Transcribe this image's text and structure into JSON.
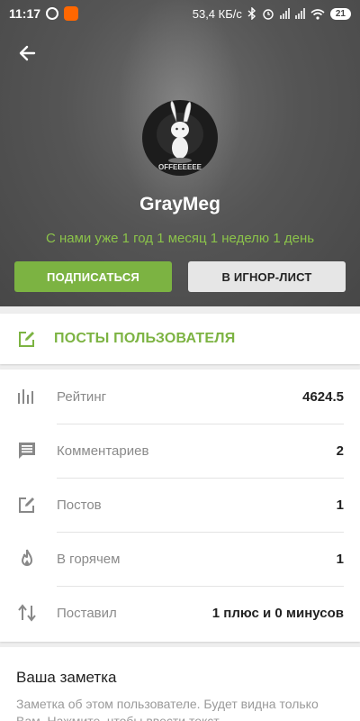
{
  "status_bar": {
    "time": "11:17",
    "net_speed": "53,4 КБ/с",
    "battery": "21",
    "icons": [
      "whatsapp-icon",
      "mi-app-icon",
      "bluetooth-icon",
      "alarm-icon",
      "signal-icon",
      "wifi-icon",
      "battery-icon"
    ]
  },
  "profile": {
    "username": "GrayMeg",
    "member_since": "С нами уже 1 год 1 месяц 1 неделю 1 день",
    "avatar_caption": "OFFEEEEEE"
  },
  "actions": {
    "subscribe_label": "ПОДПИСАТЬСЯ",
    "ignore_label": "В ИГНОР-ЛИСТ"
  },
  "posts_link": {
    "label": "ПОСТЫ ПОЛЬЗОВАТЕЛЯ"
  },
  "stats": [
    {
      "icon": "bar-chart-icon",
      "label": "Рейтинг",
      "value": "4624.5"
    },
    {
      "icon": "comment-icon",
      "label": "Комментариев",
      "value": "2"
    },
    {
      "icon": "edit-icon",
      "label": "Постов",
      "value": "1"
    },
    {
      "icon": "flame-icon",
      "label": "В горячем",
      "value": "1"
    },
    {
      "icon": "swap-vertical-icon",
      "label": "Поставил",
      "value": "1 плюс и 0 минусов"
    }
  ],
  "note": {
    "title": "Ваша заметка",
    "text": "Заметка об этом пользователе. Будет видна только Вам. Нажмите, чтобы ввести текст."
  },
  "colors": {
    "accent": "#7cb342",
    "since_text": "#8bc34a",
    "header_bg": "#555555",
    "background": "#eeeeee"
  }
}
